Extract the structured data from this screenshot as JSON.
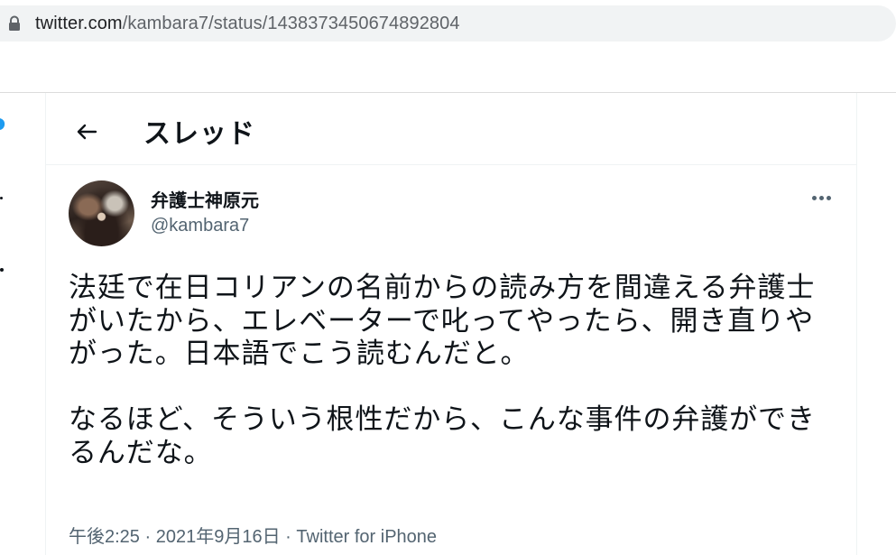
{
  "browser": {
    "url_host": "twitter.com",
    "url_path": "/kambara7/status/1438373450674892804"
  },
  "header": {
    "title": "スレッド"
  },
  "tweet": {
    "display_name": "弁護士神原元",
    "handle": "@kambara7",
    "text": "法廷で在日コリアンの名前からの読み方を間違える弁護士がいたから、エレベーターで叱ってやったら、開き直りやがった。日本語でこう読むんだと。\n\nなるほど、そういう根性だから、こんな事件の弁護ができるんだな。",
    "time": "午後2:25",
    "date": "2021年9月16日",
    "source": "Twitter for iPhone",
    "separator": "·"
  },
  "colors": {
    "accent": "#1d9bf0",
    "text": "#0f1419",
    "secondary": "#536471"
  },
  "icons": {
    "lock": "lock-icon",
    "back": "arrow-left-icon",
    "more": "more-horizontal-icon",
    "brand": "twitter-bird-icon"
  }
}
